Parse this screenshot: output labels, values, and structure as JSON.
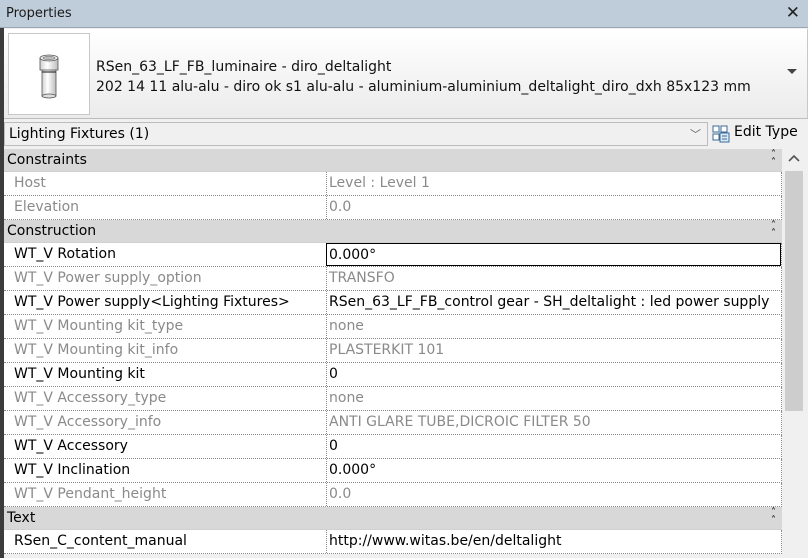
{
  "window": {
    "title": "Properties",
    "close_icon": "close-x-icon"
  },
  "type_selector": {
    "preview_icon": "cylinder-luminaire-icon",
    "family": "RSen_63_LF_FB_luminaire - diro_deltalight",
    "type": "202 14 11 alu-alu - diro ok s1 alu-alu - aluminium-aluminium_deltalight_diro_dxh 85x123 mm",
    "dropdown_icon": "triangle-down-icon"
  },
  "filter": {
    "value": "Lighting Fixtures (1)",
    "dropdown_icon": "chevron-down-icon",
    "edit_type_label": "Edit Type",
    "edit_type_icon": "edit-type-icon"
  },
  "groups": [
    {
      "label": "Constraints",
      "collapse_icon": "double-chevron-up-icon",
      "rows": [
        {
          "name": "Host",
          "value": "Level : Level 1",
          "readonly": true
        },
        {
          "name": "Elevation",
          "value": "0.0",
          "readonly": true
        }
      ]
    },
    {
      "label": "Construction",
      "collapse_icon": "double-chevron-up-icon",
      "rows": [
        {
          "name": "WT_V Rotation",
          "value": "0.000°",
          "readonly": false,
          "editing": true
        },
        {
          "name": "WT_V Power supply_option",
          "value": "TRANSFO",
          "readonly": true
        },
        {
          "name": "WT_V Power supply<Lighting Fixtures>",
          "value": "RSen_63_LF_FB_control gear - SH_deltalight : led power supply",
          "readonly": false
        },
        {
          "name": "WT_V Mounting kit_type",
          "value": "none",
          "readonly": true
        },
        {
          "name": "WT_V Mounting kit_info",
          "value": "PLASTERKIT 101",
          "readonly": true
        },
        {
          "name": "WT_V Mounting kit",
          "value": "0",
          "readonly": false
        },
        {
          "name": "WT_V Accessory_type",
          "value": "none",
          "readonly": true
        },
        {
          "name": "WT_V Accessory_info",
          "value": "ANTI GLARE TUBE,DICROIC FILTER 50",
          "readonly": true
        },
        {
          "name": "WT_V Accessory",
          "value": "0",
          "readonly": false
        },
        {
          "name": "WT_V Inclination",
          "value": "0.000°",
          "readonly": false
        },
        {
          "name": "WT_V Pendant_height",
          "value": "0.0",
          "readonly": true
        }
      ]
    },
    {
      "label": "Text",
      "collapse_icon": "double-chevron-up-icon",
      "rows": [
        {
          "name": "RSen_C_content_manual",
          "value": "http://www.witas.be/en/deltalight",
          "readonly": false
        }
      ]
    }
  ],
  "scrollbar": {
    "up_icon": "chevron-up-icon"
  }
}
